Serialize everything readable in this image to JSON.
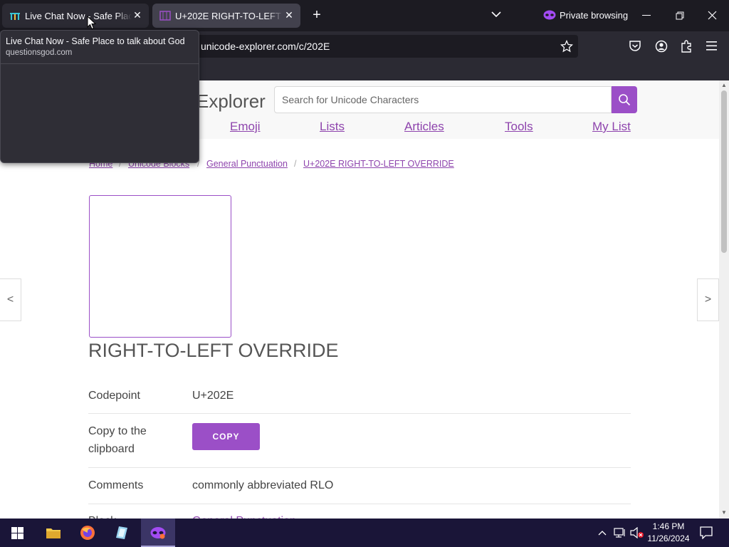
{
  "browser": {
    "tabs": [
      {
        "title": "Live Chat Now - Safe Place to talk about God",
        "active": false
      },
      {
        "title": "U+202E RIGHT-TO-LEFT OVERRIDE",
        "active": true
      }
    ],
    "private_label": "Private browsing",
    "url": "unicode-explorer.com/c/202E",
    "tooltip": {
      "title": "Live Chat Now - Safe Place to talk about God",
      "domain": "questionsgod.com"
    }
  },
  "site": {
    "logo_text": "Explorer",
    "search_placeholder": "Search for Unicode Characters",
    "nav": [
      "Emoji",
      "Lists",
      "Articles",
      "Tools",
      "My List"
    ],
    "breadcrumb": [
      "Home",
      "Unicode Blocks",
      "General Punctuation",
      "U+202E RIGHT-TO-LEFT OVERRIDE"
    ],
    "char_name": "RIGHT-TO-LEFT OVERRIDE",
    "prev_arrow": "<",
    "next_arrow": ">",
    "details": {
      "codepoint_label": "Codepoint",
      "codepoint_value": "U+202E",
      "copy_label": "Copy to the clipboard",
      "copy_button": "COPY",
      "comments_label": "Comments",
      "comments_value": "commonly abbreviated RLO",
      "block_label": "Block",
      "block_value": "General Punctuation"
    }
  },
  "taskbar": {
    "time": "1:46 PM",
    "date": "11/26/2024"
  },
  "colors": {
    "accent": "#9b4fc7",
    "link": "#8e44ad",
    "chrome_dark": "#1c1b22",
    "taskbar": "#1a1538"
  }
}
